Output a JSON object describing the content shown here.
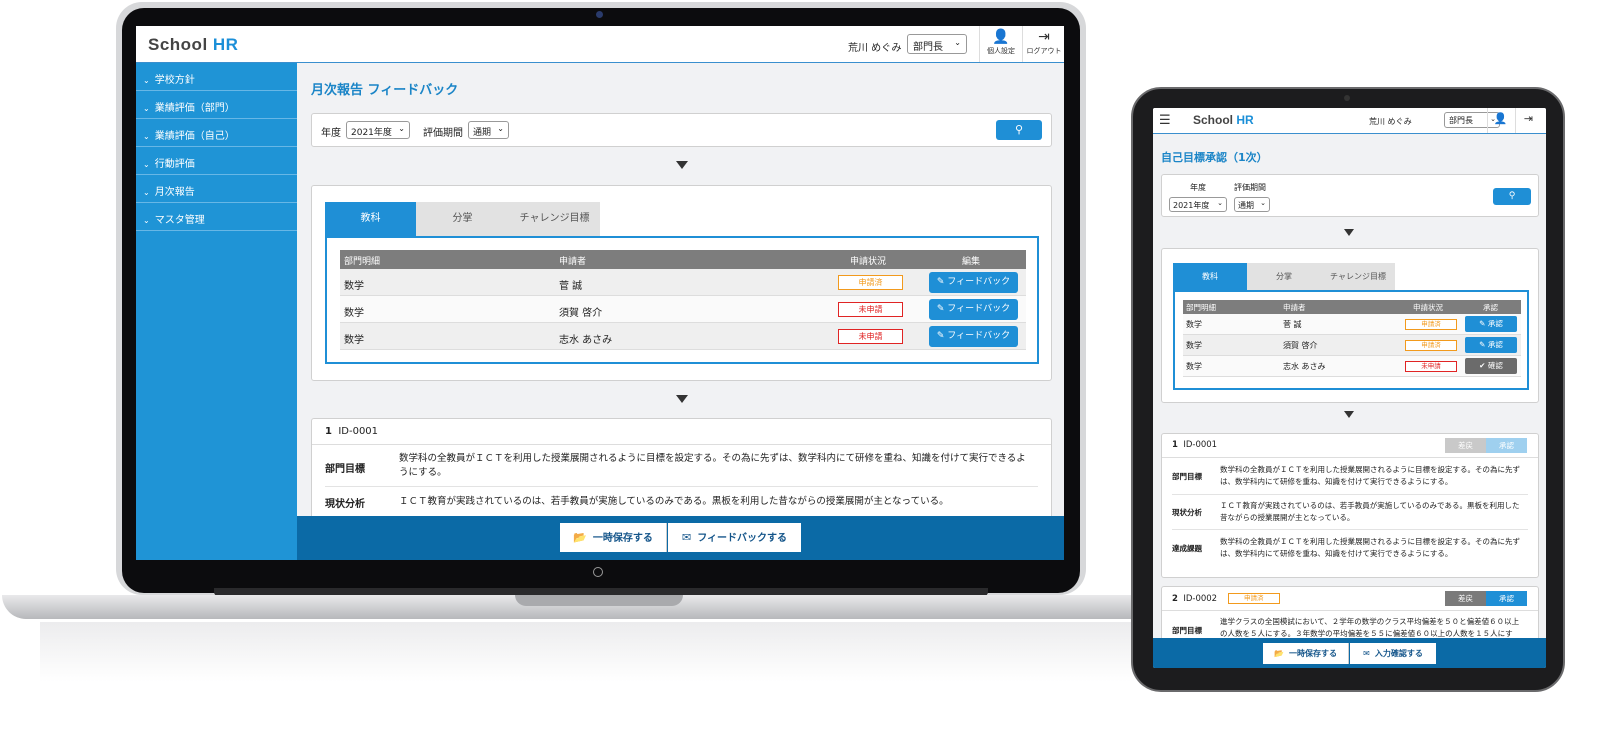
{
  "laptop": {
    "logo": {
      "text": "School ",
      "accent": "HR"
    },
    "header": {
      "user_name": "荒川 めぐみ",
      "role": "部門長",
      "profile_label": "個人設定",
      "logout_label": "ログアウト"
    },
    "sidebar": {
      "items": [
        {
          "label": "学校方針"
        },
        {
          "label": "業績評価（部門）"
        },
        {
          "label": "業績評価（自己）"
        },
        {
          "label": "行動評価"
        },
        {
          "label": "月次報告"
        },
        {
          "label": "マスタ管理"
        }
      ]
    },
    "page_title": "月次報告 フィードバック",
    "search": {
      "year_label": "年度",
      "year_value": "2021年度",
      "period_label": "評価期間",
      "period_value": "通期"
    },
    "tabs": [
      "教科",
      "分掌",
      "チャレンジ目標"
    ],
    "table": {
      "headers": [
        "部門明細",
        "申請者",
        "申請状況",
        "編集"
      ],
      "rows": [
        {
          "dept": "数学",
          "applicant": "菅 誠",
          "status": "申請済",
          "action": "フィードバック"
        },
        {
          "dept": "数学",
          "applicant": "須賀 啓介",
          "status": "未申請",
          "action": "フィードバック"
        },
        {
          "dept": "数学",
          "applicant": "志水 あさみ",
          "status": "未申請",
          "action": "フィードバック"
        }
      ]
    },
    "detail": {
      "num": "1",
      "id": "ID-0001",
      "rows": [
        {
          "key": "部門目標",
          "value": "数学科の全教員がＩＣＴを利用した授業展開されるように目標を設定する。その為に先ずは、数学科内にて研修を重ね、知識を付けて実行できるようにする。"
        },
        {
          "key": "現状分析",
          "value": "ＩＣＴ教育が実践されているのは、若手教員が実施しているのみである。黒板を利用した昔ながらの授業展開が主となっている。"
        }
      ]
    },
    "bottom": {
      "save_label": "一時保存する",
      "feedback_label": "フィードバックする"
    }
  },
  "tablet": {
    "logo": {
      "text": "School ",
      "accent": "HR"
    },
    "header": {
      "user_name": "荒川 めぐみ",
      "role": "部門長"
    },
    "page_title": "自己目標承認（1次）",
    "search": {
      "year_label": "年度",
      "year_value": "2021年度",
      "period_label": "評価期間",
      "period_value": "通期"
    },
    "tabs": [
      "教科",
      "分掌",
      "チャレンジ目標"
    ],
    "table": {
      "headers": [
        "部門明細",
        "申請者",
        "申請状況",
        "承認"
      ],
      "rows": [
        {
          "dept": "数学",
          "applicant": "菅 誠",
          "status": "申請済",
          "action": "承認"
        },
        {
          "dept": "数学",
          "applicant": "須賀 啓介",
          "status": "申請済",
          "action": "承認"
        },
        {
          "dept": "数学",
          "applicant": "志水 あさみ",
          "status": "未申請",
          "action": "確認"
        }
      ]
    },
    "detail1": {
      "num": "1",
      "id": "ID-0001",
      "reject_label": "差戻",
      "approve_label": "承認",
      "rows": [
        {
          "key": "部門目標",
          "value": "数学科の全教員がＩＣＴを利用した授業展開されるように目標を設定する。その為に先ずは、数学科内にて研修を重ね、知識を付けて実行できるようにする。"
        },
        {
          "key": "現状分析",
          "value": "ＩＣＴ教育が実践されているのは、若手教員が実施しているのみである。黒板を利用した昔ながらの授業展開が主となっている。"
        },
        {
          "key": "達成課題",
          "value": "数学科の全教員がＩＣＴを利用した授業展開されるように目標を設定する。その為に先ずは、数学科内にて研修を重ね、知識を付けて実行できるようにする。"
        }
      ]
    },
    "detail2": {
      "num": "2",
      "id": "ID-0002",
      "status": "申請済",
      "reject_label": "差戻",
      "approve_label": "承認",
      "row_key": "部門目標",
      "row_value": "進学クラスの全国模試において、２学年の数学のクラス平均偏差を５０と偏差値６０以上の人数を５人にする。３年数学の平均偏差を５５に偏差値６０以上の人数を１５人にす"
    },
    "bottom": {
      "save_label": "一時保存する",
      "confirm_label": "入力確認する"
    }
  },
  "colors": {
    "brand_blue": "#1f8fd6",
    "dark_blue": "#0b6aa6",
    "applied_orange": "#f29a1d",
    "not_applied_red": "#e02424"
  }
}
